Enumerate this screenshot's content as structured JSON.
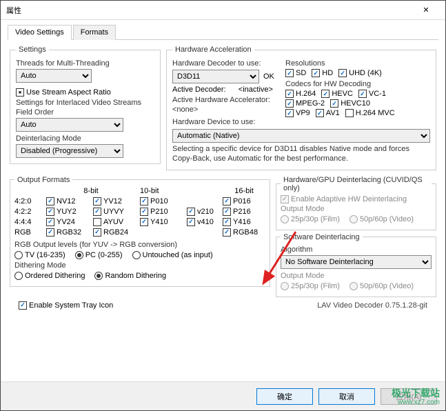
{
  "window": {
    "title": "属性",
    "close_icon": "✕"
  },
  "tabs": {
    "video": "Video Settings",
    "formats": "Formats"
  },
  "settings": {
    "legend": "Settings",
    "threads_label": "Threads for Multi-Threading",
    "threads_value": "Auto",
    "use_stream_ar": "Use Stream Aspect Ratio",
    "interlaced_label": "Settings for Interlaced Video Streams",
    "field_order_label": "Field Order",
    "field_order_value": "Auto",
    "deint_mode_label": "Deinterlacing Mode",
    "deint_mode_value": "Disabled (Progressive)"
  },
  "hwaccel": {
    "legend": "Hardware Acceleration",
    "decoder_label": "Hardware Decoder to use:",
    "decoder_value": "D3D11",
    "decoder_ok": "OK",
    "active_decoder_label": "Active Decoder:",
    "active_decoder_value": "<inactive>",
    "active_accel_label": "Active Hardware Accelerator:",
    "active_accel_value": "<none>",
    "device_label": "Hardware Device to use:",
    "device_value": "Automatic (Native)",
    "note": "Selecting a specific device for D3D11 disables Native mode and forces Copy-Back, use Automatic for the best performance.",
    "res_label": "Resolutions",
    "res": {
      "sd": "SD",
      "hd": "HD",
      "uhd": "UHD (4K)"
    },
    "codecs_label": "Codecs for HW Decoding",
    "codecs": {
      "h264": "H.264",
      "hevc": "HEVC",
      "vc1": "VC-1",
      "mpeg2": "MPEG-2",
      "hevc10": "HEVC10",
      "vp9": "VP9",
      "av1": "AV1",
      "h264mvc": "H.264 MVC"
    }
  },
  "fmt": {
    "legend": "Output Formats",
    "hdr8": "8-bit",
    "hdr10": "10-bit",
    "hdr16": "16-bit",
    "r420": "4:2:0",
    "r422": "4:2:2",
    "r444": "4:4:4",
    "rrgb": "RGB",
    "nv12": "NV12",
    "yv12": "YV12",
    "p010": "P010",
    "p016": "P016",
    "yuy2": "YUY2",
    "uyvy": "UYVY",
    "p210": "P210",
    "v210": "v210",
    "p216": "P216",
    "yv24": "YV24",
    "ayuv": "AYUV",
    "y410": "Y410",
    "v410": "v410",
    "y416": "Y416",
    "rgb32": "RGB32",
    "rgb24": "RGB24",
    "rgb48": "RGB48",
    "rgb_levels_label": "RGB Output levels (for YUV -> RGB conversion)",
    "tv": "TV (16-235)",
    "pc": "PC (0-255)",
    "untouched": "Untouched (as input)",
    "dither_label": "Dithering Mode",
    "dither_ordered": "Ordered Dithering",
    "dither_random": "Random Dithering"
  },
  "hwdeint": {
    "legend": "Hardware/GPU Deinterlacing (CUVID/QS only)",
    "adaptive": "Enable Adaptive HW Deinterlacing",
    "outmode": "Output Mode",
    "r25": "25p/30p (Film)",
    "r50": "50p/60p (Video)"
  },
  "swdeint": {
    "legend": "Software Deinterlacing",
    "algo_label": "Algorithm",
    "algo_value": "No Software Deinterlacing",
    "outmode": "Output Mode",
    "r25": "25p/30p (Film)",
    "r50": "50p/60p (Video)"
  },
  "footer": {
    "tray": "Enable System Tray Icon",
    "version": "LAV Video Decoder 0.75.1.28-git"
  },
  "buttons": {
    "ok": "确定",
    "cancel": "取消",
    "apply": "应用(A)"
  },
  "watermark": {
    "line1": "极光下载站",
    "line2": "www.xz7.com"
  }
}
